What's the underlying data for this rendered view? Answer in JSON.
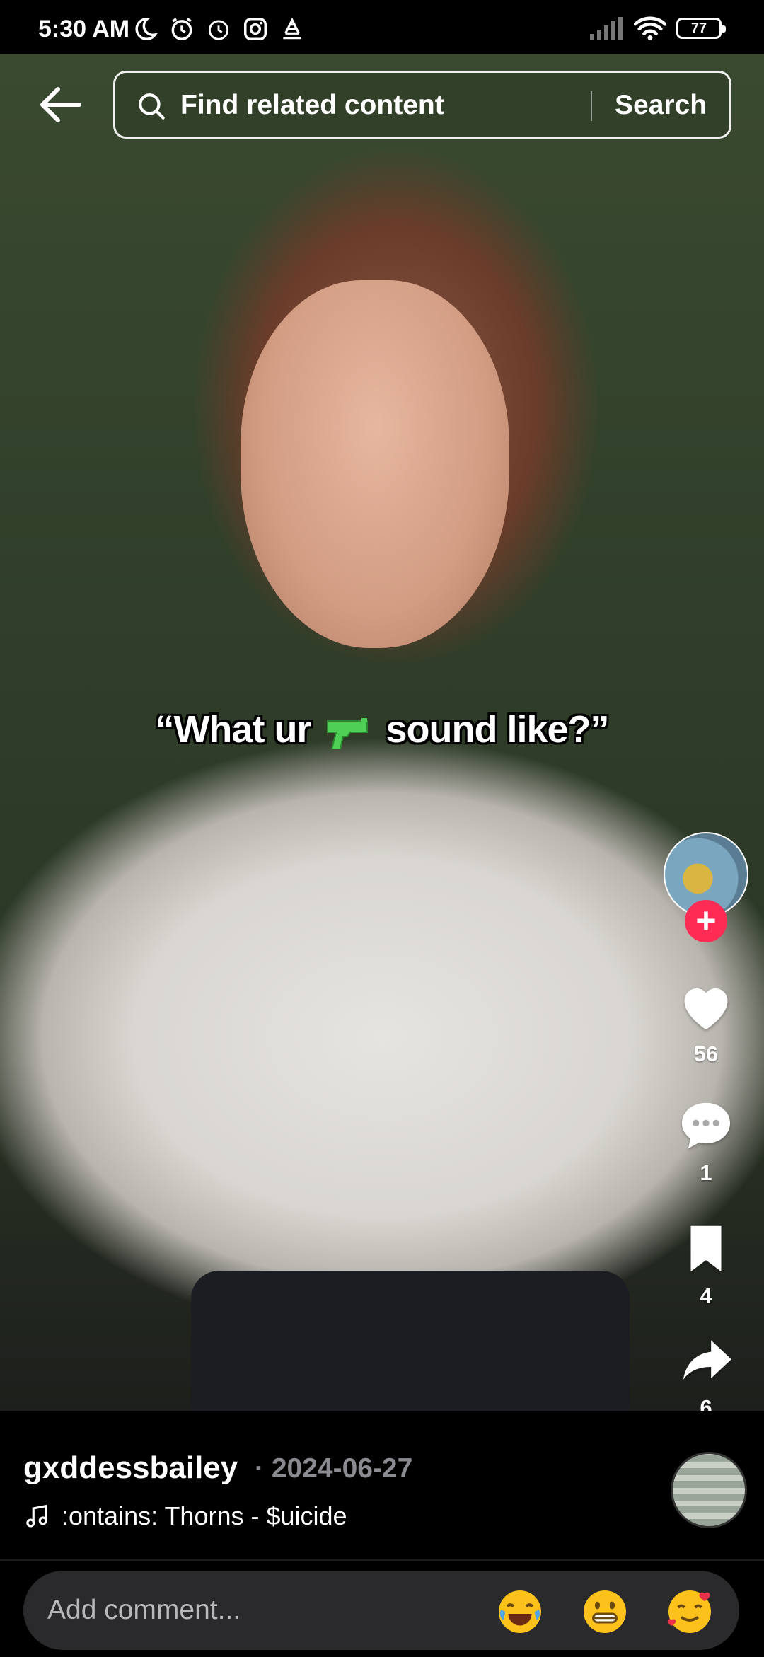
{
  "status_bar": {
    "time": "5:30 AM",
    "battery": "77",
    "icons_left": [
      "moon-icon",
      "alarm-icon",
      "alarm-clock-icon",
      "instagram-icon",
      "voicemail-icon"
    ],
    "icons_right": [
      "signal-icon",
      "wifi-icon",
      "battery-icon"
    ]
  },
  "header": {
    "back_icon": "arrow-left-icon",
    "search_placeholder": "Find related content",
    "search_button": "Search"
  },
  "video": {
    "caption_before": "“What ur",
    "caption_emoji": "water-pistol-icon",
    "caption_after": "sound like?”"
  },
  "rail": {
    "likes": "56",
    "comments": "1",
    "saves": "4",
    "shares": "6"
  },
  "info": {
    "username": "gxddessbailey",
    "date": "· 2024-06-27",
    "music": ":ontains: Thorns - $uicide"
  },
  "comment": {
    "placeholder": "Add comment...",
    "emojis": [
      "joy-emoji",
      "grin-emoji",
      "smiling-hearts-emoji"
    ]
  },
  "colors": {
    "accent": "#fe2c55",
    "background": "#000000",
    "comment_bar": "#2a2a2c",
    "muted_text": "#8a8b91"
  }
}
